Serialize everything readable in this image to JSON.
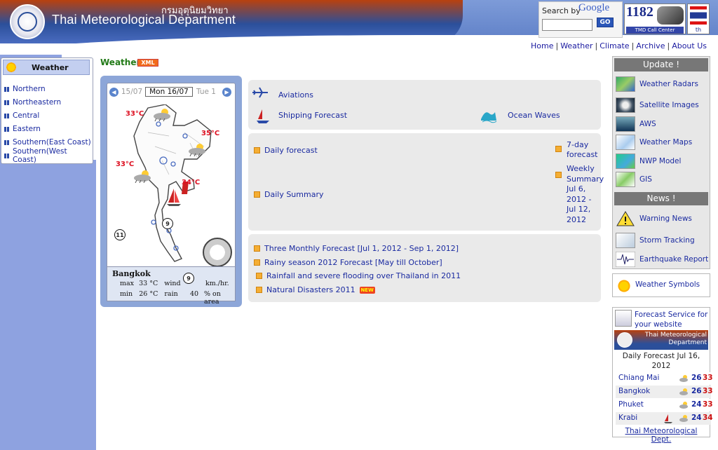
{
  "header": {
    "thai_title": "กรมอุตุนิยมวิทยา",
    "title": "Thai Meteorological Department",
    "search_label": "Search by",
    "google_label": "Google",
    "search_value": "",
    "go_label": "GO",
    "call_center_number": "1182",
    "call_center_label": "TMD Call Center",
    "lang_label": "th"
  },
  "topnav": [
    "Home",
    "Weather",
    "Climate",
    "Archive",
    "About Us"
  ],
  "left_menu": {
    "title": "Weather",
    "items": [
      "Northern",
      "Northeastern",
      "Central",
      "Eastern",
      "Southern(East Coast)",
      "Southern(West Coast)"
    ]
  },
  "main": {
    "section_title": "Weather",
    "xml_badge": "XML",
    "map": {
      "dates": [
        "15/07",
        "Mon 16/07",
        "Tue 1"
      ],
      "temps": [
        "33°C",
        "35°C",
        "33°C",
        "34°C"
      ],
      "wind_badges": [
        "9",
        "11"
      ],
      "city": {
        "name": "Bangkok",
        "max_label": "max",
        "max": "33",
        "min_label": "min",
        "min": "26",
        "unit": "°C",
        "wind_label": "wind",
        "wind_value": "9",
        "wind_unit": "km./hr.",
        "rain_label": "rain",
        "rain_value": "40",
        "rain_unit": "% on area"
      }
    },
    "panel1": {
      "aviations": "Aviations",
      "shipping": "Shipping Forecast",
      "ocean": "Ocean Waves"
    },
    "panel2": {
      "daily_forecast": "Daily forecast",
      "seven_day": "7-day forecast",
      "daily_summary": "Daily Summary",
      "weekly_summary": "Weekly Summary Jul 6, 2012 - Jul 12, 2012"
    },
    "panel3": {
      "items": [
        "Three Monthly Forecast [Jul 1, 2012 - Sep 1, 2012]",
        "Rainy season 2012 Forecast [May till October]",
        "Rainfall and severe flooding over Thailand in 2011",
        "Natural Disasters 2011"
      ],
      "new_badge": "NEW"
    }
  },
  "right": {
    "update_title": "Update !",
    "update_items": [
      "Weather Radars",
      "Satellite Images",
      "AWS",
      "Weather Maps",
      "NWP Model",
      "GIS"
    ],
    "news_title": "News !",
    "news_items": [
      "Warning News",
      "Storm Tracking",
      "Earthquake Report"
    ],
    "weather_symbols": "Weather Symbols",
    "forecast_service": "Forecast Service for your website",
    "banner_text": "Thai Meteorological Department",
    "daily_forecast_title": "Daily Forecast Jul 16, 2012",
    "cities": [
      {
        "name": "Chiang Mai",
        "min": "26",
        "max": "33"
      },
      {
        "name": "Bangkok",
        "min": "26",
        "max": "33"
      },
      {
        "name": "Phuket",
        "min": "24",
        "max": "33"
      },
      {
        "name": "Krabi",
        "min": "24",
        "max": "34"
      }
    ],
    "footer_link": "Thai Meteorological Dept."
  },
  "colors": {
    "header_blue": "#5e7fc7",
    "left_col_blue": "#8ea2e0",
    "link_blue": "#1a2aa0",
    "title_green": "#227a17",
    "temp_red": "#d11122",
    "xml_orange": "#f26b1b"
  }
}
